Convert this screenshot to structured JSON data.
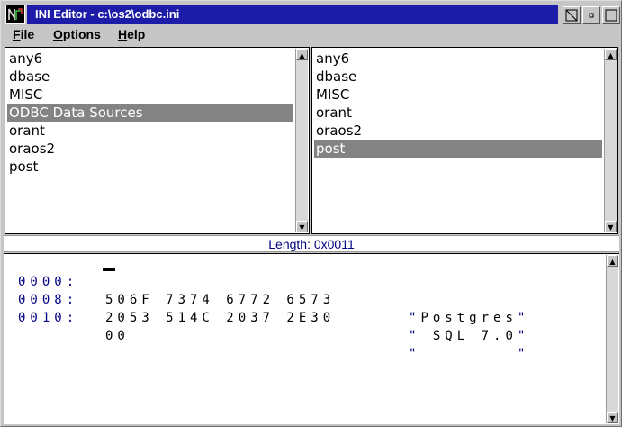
{
  "window": {
    "title": "INI Editor - c:\\os2\\odbc.ini"
  },
  "menu": {
    "file": "File",
    "options": "Options",
    "help": "Help"
  },
  "applications": {
    "items": [
      "any6",
      "dbase",
      "MISC",
      "ODBC Data Sources",
      "orant",
      "oraos2",
      "post"
    ],
    "selected": "ODBC Data Sources"
  },
  "keys": {
    "items": [
      "any6",
      "dbase",
      "MISC",
      "orant",
      "oraos2",
      "post"
    ],
    "selected": "post"
  },
  "value": {
    "length_text": "Length: 0x0011"
  },
  "hex": {
    "rows": [
      {
        "offset": "0000:",
        "bytes": "506F 7374 6772 6573",
        "ascii_open": "\"",
        "ascii_text": "Postgres",
        "ascii_close": "\""
      },
      {
        "offset": "0008:",
        "bytes": "2053 514C 2037 2E30",
        "ascii_open": "\"",
        "ascii_text": " SQL 7.0",
        "ascii_close": "\""
      },
      {
        "offset": "0010:",
        "bytes": "00",
        "ascii_open": "\"",
        "ascii_text": "        ",
        "ascii_close": "\""
      }
    ]
  },
  "colors": {
    "title_bar": "#1c1ca8",
    "selection": "#838383",
    "hex_offset": "#000080",
    "face": "#c6c6c6"
  },
  "icons": {
    "system_menu": "ini-editor-app-icon",
    "restore": "restore-icon",
    "minimize": "minimize-icon",
    "maximize": "maximize-icon",
    "scroll_up": "scroll-up-arrow-icon",
    "scroll_down": "scroll-down-arrow-icon"
  }
}
